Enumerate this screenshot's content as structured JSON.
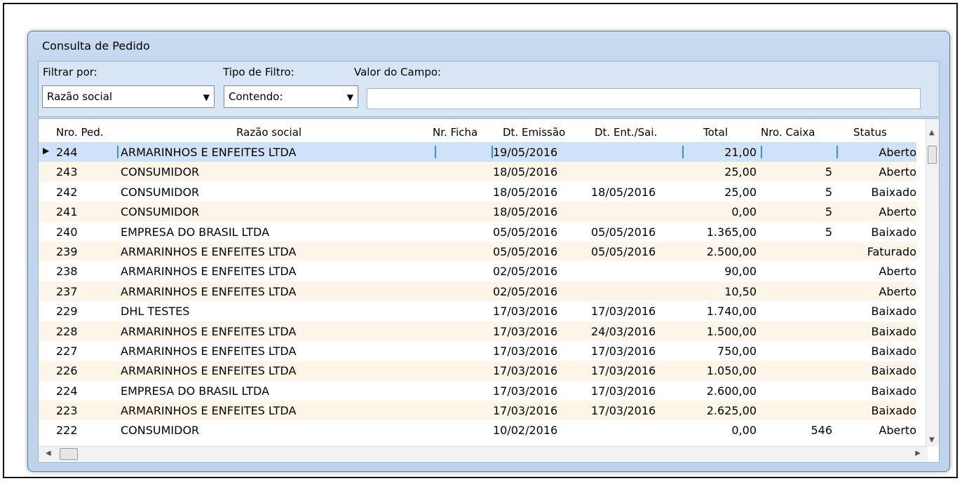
{
  "window": {
    "title": "Consulta de Pedido"
  },
  "filter": {
    "filter_by_label": "Filtrar por:",
    "filter_by_value": "Razão social",
    "filter_type_label": "Tipo de Filtro:",
    "filter_type_value": "Contendo:",
    "field_value_label": "Valor do Campo:",
    "field_value": ""
  },
  "grid": {
    "columns": [
      "Nro. Ped.",
      "Razão social",
      "Nr. Ficha",
      "Dt. Emissão",
      "Dt. Ent./Sai.",
      "Total",
      "Nro. Caixa",
      "Status"
    ],
    "rows": [
      {
        "nro": "244",
        "razao": "ARMARINHOS E ENFEITES LTDA",
        "ficha": "",
        "emissao": "19/05/2016",
        "entsai": "",
        "total": "21,00",
        "caixa": "",
        "status": "Aberto"
      },
      {
        "nro": "243",
        "razao": "CONSUMIDOR",
        "ficha": "",
        "emissao": "18/05/2016",
        "entsai": "",
        "total": "25,00",
        "caixa": "5",
        "status": "Aberto"
      },
      {
        "nro": "242",
        "razao": "CONSUMIDOR",
        "ficha": "",
        "emissao": "18/05/2016",
        "entsai": "18/05/2016",
        "total": "25,00",
        "caixa": "5",
        "status": "Baixado"
      },
      {
        "nro": "241",
        "razao": "CONSUMIDOR",
        "ficha": "",
        "emissao": "18/05/2016",
        "entsai": "",
        "total": "0,00",
        "caixa": "5",
        "status": "Aberto"
      },
      {
        "nro": "240",
        "razao": "EMPRESA DO BRASIL LTDA",
        "ficha": "",
        "emissao": "05/05/2016",
        "entsai": "05/05/2016",
        "total": "1.365,00",
        "caixa": "5",
        "status": "Baixado"
      },
      {
        "nro": "239",
        "razao": "ARMARINHOS E ENFEITES LTDA",
        "ficha": "",
        "emissao": "05/05/2016",
        "entsai": "05/05/2016",
        "total": "2.500,00",
        "caixa": "",
        "status": "Faturado"
      },
      {
        "nro": "238",
        "razao": "ARMARINHOS E ENFEITES LTDA",
        "ficha": "",
        "emissao": "02/05/2016",
        "entsai": "",
        "total": "90,00",
        "caixa": "",
        "status": "Aberto"
      },
      {
        "nro": "237",
        "razao": "ARMARINHOS E ENFEITES LTDA",
        "ficha": "",
        "emissao": "02/05/2016",
        "entsai": "",
        "total": "10,50",
        "caixa": "",
        "status": "Aberto"
      },
      {
        "nro": "229",
        "razao": "DHL TESTES",
        "ficha": "",
        "emissao": "17/03/2016",
        "entsai": "17/03/2016",
        "total": "1.740,00",
        "caixa": "",
        "status": "Baixado"
      },
      {
        "nro": "228",
        "razao": "ARMARINHOS E ENFEITES LTDA",
        "ficha": "",
        "emissao": "17/03/2016",
        "entsai": "24/03/2016",
        "total": "1.500,00",
        "caixa": "",
        "status": "Baixado"
      },
      {
        "nro": "227",
        "razao": "ARMARINHOS E ENFEITES LTDA",
        "ficha": "",
        "emissao": "17/03/2016",
        "entsai": "17/03/2016",
        "total": "750,00",
        "caixa": "",
        "status": "Baixado"
      },
      {
        "nro": "226",
        "razao": "ARMARINHOS E ENFEITES LTDA",
        "ficha": "",
        "emissao": "17/03/2016",
        "entsai": "17/03/2016",
        "total": "1.050,00",
        "caixa": "",
        "status": "Baixado"
      },
      {
        "nro": "224",
        "razao": "EMPRESA DO BRASIL LTDA",
        "ficha": "",
        "emissao": "17/03/2016",
        "entsai": "17/03/2016",
        "total": "2.600,00",
        "caixa": "",
        "status": "Baixado"
      },
      {
        "nro": "223",
        "razao": "ARMARINHOS E ENFEITES LTDA",
        "ficha": "",
        "emissao": "17/03/2016",
        "entsai": "17/03/2016",
        "total": "2.625,00",
        "caixa": "",
        "status": "Baixado"
      },
      {
        "nro": "222",
        "razao": "CONSUMIDOR",
        "ficha": "",
        "emissao": "10/02/2016",
        "entsai": "",
        "total": "0,00",
        "caixa": "546",
        "status": "Aberto"
      }
    ],
    "selected_index": 0
  },
  "icons": {
    "combo_arrow": "chevron-down-icon",
    "row_indicator": "current-row-pointer-icon",
    "scroll_up": "scroll-up-icon",
    "scroll_down": "scroll-down-icon",
    "scroll_left": "scroll-left-icon",
    "scroll_right": "scroll-right-icon"
  },
  "colors": {
    "selected_row": "#cfe2f8",
    "alt_row": "#fdf5e8",
    "window_frame": "#c9dcf1"
  }
}
